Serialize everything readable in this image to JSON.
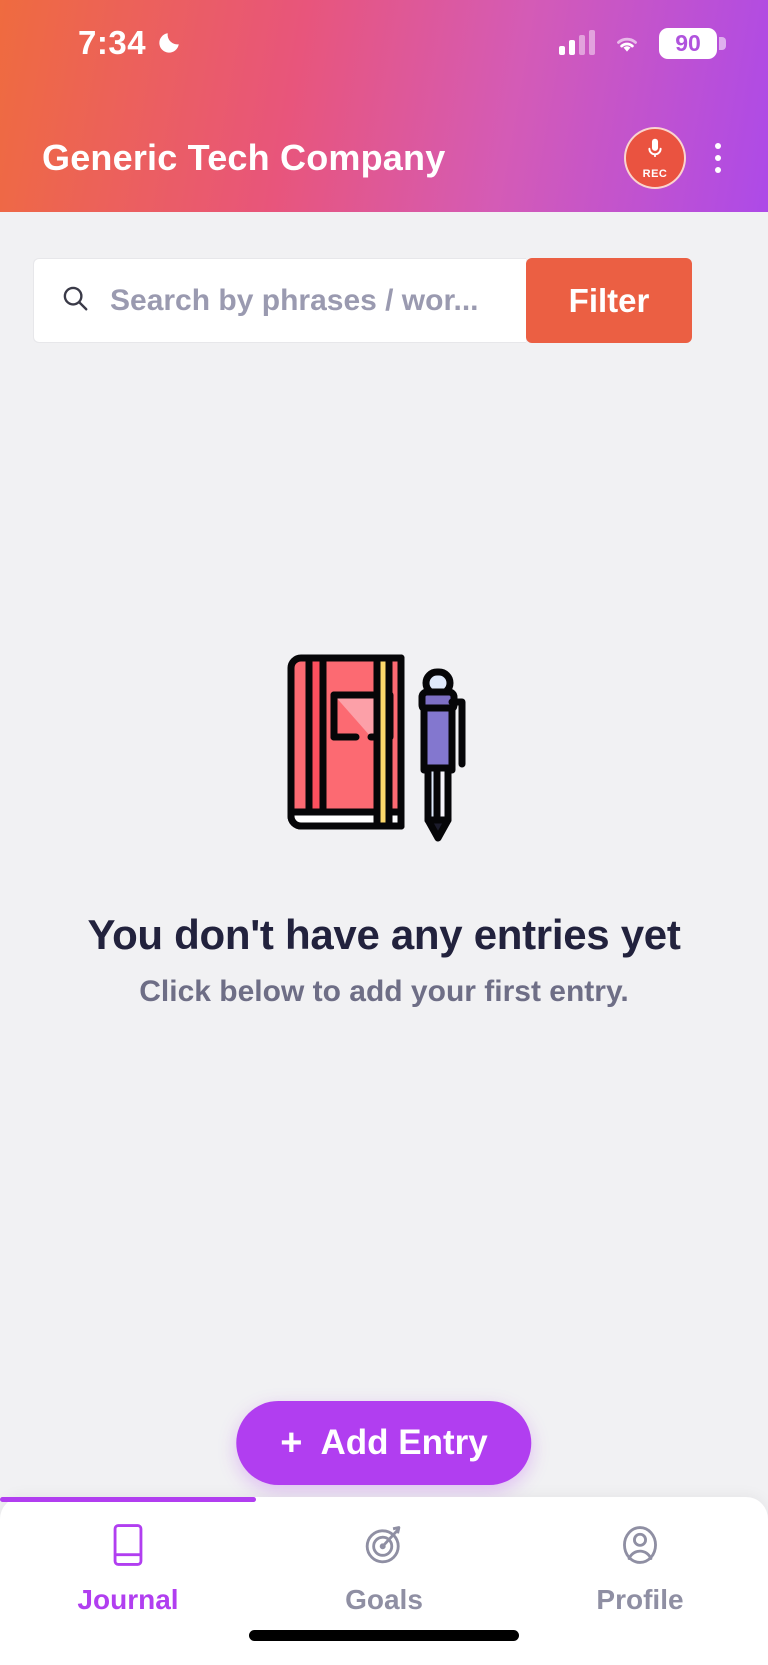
{
  "status_bar": {
    "time": "7:34",
    "moon_icon": "crescent-moon-icon",
    "signal_icon": "cellular-signal-icon",
    "wifi_icon": "wifi-icon",
    "battery_level": "90",
    "battery_icon": "battery-icon"
  },
  "app_bar": {
    "title": "Generic Tech Company",
    "record_button": {
      "icon": "microphone-icon",
      "label": "REC"
    },
    "menu_icon": "kebab-menu-icon"
  },
  "search": {
    "icon": "search-icon",
    "placeholder": "Search by phrases / wor...",
    "value": "",
    "filter_label": "Filter"
  },
  "empty_state": {
    "illustration": "notebook-and-pen-illustration",
    "title": "You don't have any entries yet",
    "subtitle": "Click below to add your first entry."
  },
  "add_entry": {
    "plus": "+",
    "label": "Add Entry"
  },
  "bottom_nav": {
    "items": [
      {
        "label": "Journal",
        "icon": "book-icon",
        "active": true
      },
      {
        "label": "Goals",
        "icon": "target-icon",
        "active": false
      },
      {
        "label": "Profile",
        "icon": "person-circle-icon",
        "active": false
      }
    ]
  },
  "colors": {
    "gradient_start": "#ef6b3f",
    "gradient_end": "#ad4ae8",
    "accent_purple": "#b13ef0",
    "filter_orange": "#eb5f43",
    "rec_red": "#ea5340",
    "title_navy": "#22223d",
    "muted_text": "#6e6e86",
    "background": "#f1f1f3"
  }
}
